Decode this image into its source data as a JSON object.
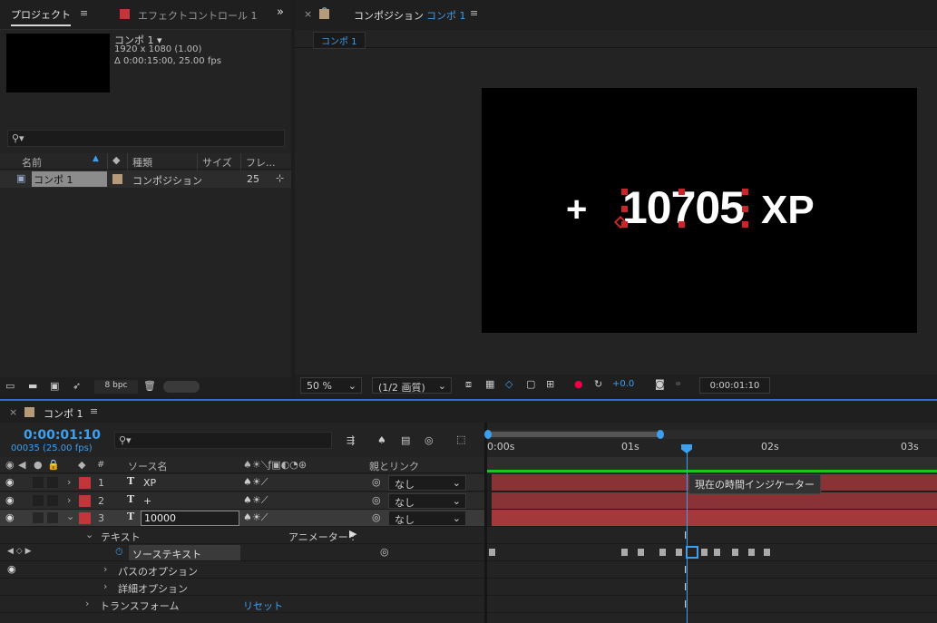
{
  "project_panel": {
    "tab_project": "プロジェクト",
    "tab_effects": "エフェクトコントロール 1",
    "comp_name": "コンポ 1 ▾",
    "comp_res": "1920 x 1080 (1.00)",
    "comp_duration": "Δ 0:00:15:00, 25.00 fps",
    "search_placeholder": "",
    "col_name": "名前",
    "col_type": "種類",
    "col_size": "サイズ",
    "col_frame": "フレ...",
    "item_name": "コンポ 1",
    "item_type": "コンポジション",
    "item_frame": "25",
    "bpc": "8 bpc"
  },
  "comp_viewer": {
    "tab_prefix": "コンポジション",
    "tab_name": "コンポ 1",
    "sub_tab": "コンポ 1",
    "plus_text": "+",
    "number_text": "10705",
    "xp_text": "XP",
    "zoom": "50 %",
    "resolution": "(1/2 画質)",
    "exposure": "+0.0",
    "timecode": "0:00:01:10"
  },
  "timeline": {
    "tab_name": "コンポ 1",
    "current_time": "0:00:01:10",
    "frame_info": "00035 (25.00 fps)",
    "search_placeholder": "",
    "col_num": "#",
    "col_source": "ソース名",
    "col_parent": "親とリンク",
    "layers": [
      {
        "num": "1",
        "name": "XP",
        "parent": "なし",
        "color": "#c2353a"
      },
      {
        "num": "2",
        "name": "+",
        "parent": "なし",
        "color": "#c2353a"
      },
      {
        "num": "3",
        "name": "10000",
        "parent": "なし",
        "color": "#c2353a"
      }
    ],
    "prop_text": "テキスト",
    "animator": "アニメーター :",
    "source_text": "ソーステキスト",
    "path_options": "パスのオプション",
    "more_options": "詳細オプション",
    "transform": "トランスフォーム",
    "reset": "リセット",
    "ruler": [
      "0:00s",
      "01s",
      "02s",
      "03s"
    ],
    "tooltip": "現在の時間インジケーター"
  },
  "colors": {
    "accent": "#3d9ff0",
    "layer_label": "#c2353a",
    "work_area": "#1fc31f"
  }
}
